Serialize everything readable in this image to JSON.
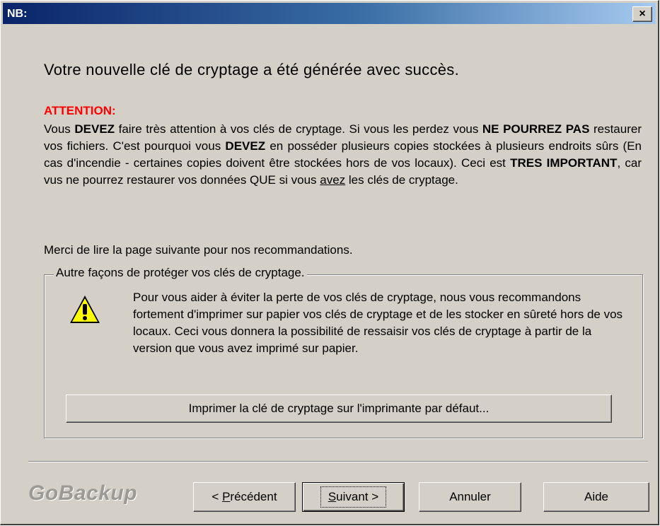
{
  "window": {
    "title": "NB:",
    "close_glyph": "×"
  },
  "heading": "Votre nouvelle clé de cryptage a été générée avec succès.",
  "attention": "ATTENTION:",
  "paragraph": {
    "t1": "Vous ",
    "b1": "DEVEZ",
    "t2": " faire très attention à vos clés de cryptage. Si vous les perdez vous ",
    "b2": "NE POURREZ PAS",
    "t3": "  restaurer vos fichiers. C'est pourquoi vous ",
    "b3": "DEVEZ",
    "t4": " en posséder plusieurs copies stockées à plusieurs endroits sûrs (En cas d'incendie - certaines copies doivent être stockées hors de vos locaux). Ceci est ",
    "b4": "TRES IMPORTANT",
    "t5": ", car vus ne pourrez restaurer vos données QUE si vous ",
    "u1": "avez",
    "t6": " les clés de cryptage."
  },
  "merci": "Merci de lire la page suivante pour nos recommandations.",
  "group": {
    "legend": "Autre façons de protéger vos clés de cryptage.",
    "text": "Pour vous aider à éviter la perte de vos clés de cryptage, nous vous recommandons fortement d'imprimer sur papier vos clés de cryptage et de les stocker en sûreté hors de vos locaux.  Ceci vous donnera la possibilité de ressaisir vos clés de cryptage à partir de la version que vous avez imprimé sur papier.",
    "icon": "warning-icon",
    "print_button": "Imprimer la clé de cryptage sur l'imprimante par défaut..."
  },
  "footer": {
    "logo": "GoBackup",
    "prev_pre": "< ",
    "prev_accel": "P",
    "prev_rest": "récédent",
    "next_accel": "S",
    "next_rest": "uivant >",
    "cancel": "Annuler",
    "help": "Aide"
  }
}
